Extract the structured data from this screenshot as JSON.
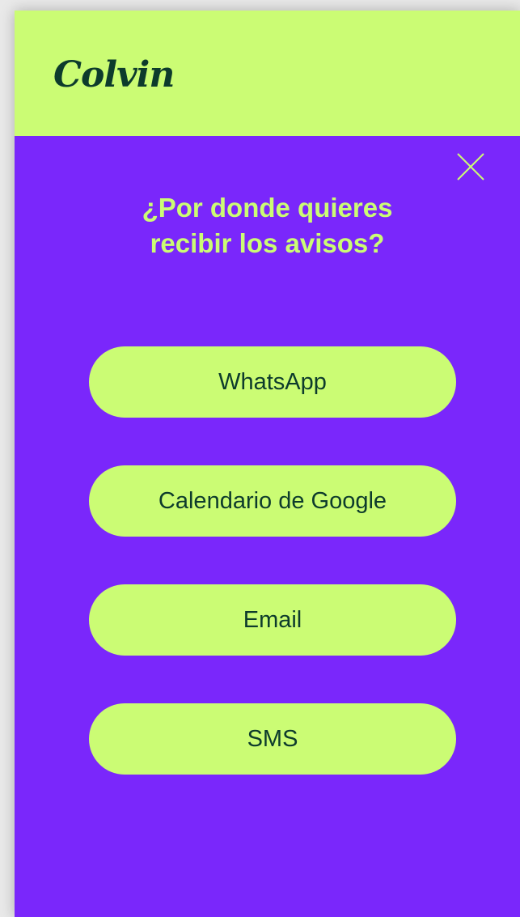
{
  "brand": {
    "logo_text": "Colvin"
  },
  "dialog": {
    "title_line1": "¿Por donde quieres",
    "title_line2": "recibir los avisos?",
    "close_icon": "close-icon",
    "options": [
      {
        "label": "WhatsApp"
      },
      {
        "label": "Calendario de Google"
      },
      {
        "label": "Email"
      },
      {
        "label": "SMS"
      }
    ]
  },
  "colors": {
    "background": "#7a27fb",
    "accent": "#cbfc74",
    "text_dark": "#0d3b2c"
  }
}
